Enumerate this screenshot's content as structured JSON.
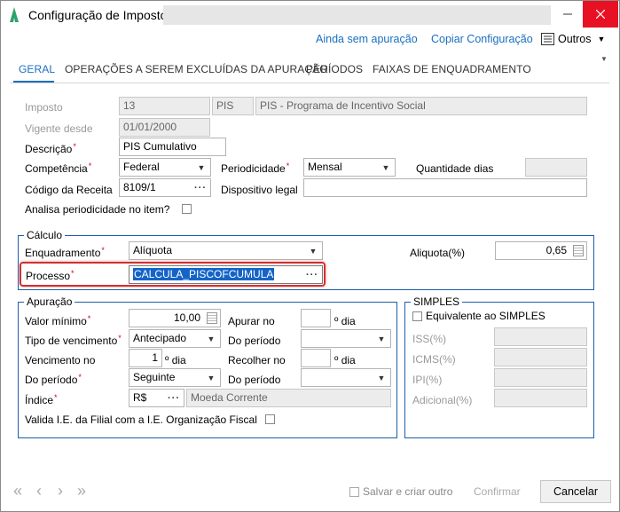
{
  "window": {
    "title": "Configuração de Impostos"
  },
  "toolbar": {
    "link_no_calc": "Ainda sem apuração",
    "link_copy": "Copiar Configuração",
    "others_label": "Outros"
  },
  "tabs": [
    {
      "label": "GERAL",
      "active": true
    },
    {
      "label": "OPERAÇÕES A SEREM EXCLUÍDAS DA APURAÇÃO",
      "active": false
    },
    {
      "label": "PERÍODOS",
      "active": false
    },
    {
      "label": "FAIXAS DE ENQUADRAMENTO",
      "active": false
    }
  ],
  "general": {
    "imposto_label": "Imposto",
    "imposto_code": "13",
    "imposto_sigla": "PIS",
    "imposto_nome": "PIS - Programa de Incentivo Social",
    "vigente_label": "Vigente desde",
    "vigente_value": "01/01/2000",
    "descricao_label": "Descrição",
    "descricao_value": "PIS Cumulativo",
    "competencia_label": "Competência",
    "competencia_value": "Federal",
    "periodicidade_label": "Periodicidade",
    "periodicidade_value": "Mensal",
    "qtd_dias_label": "Quantidade dias",
    "qtd_dias_value": "",
    "codigo_receita_label": "Código da Receita",
    "codigo_receita_value": "8109/1",
    "dispositivo_label": "Dispositivo legal",
    "dispositivo_value": "",
    "analisa_label": "Analisa periodicidade no item?"
  },
  "calculo": {
    "title": "Cálculo",
    "enquadramento_label": "Enquadramento",
    "enquadramento_value": "Alíquota",
    "aliquota_label": "Aliquota(%)",
    "aliquota_value": "0,65",
    "processo_label": "Processo",
    "processo_value": "CALCULA_PISCOFCUMULA"
  },
  "apuracao": {
    "title": "Apuração",
    "valor_minimo_label": "Valor mínimo",
    "valor_minimo_value": "10,00",
    "tipo_venc_label": "Tipo de vencimento",
    "tipo_venc_value": "Antecipado",
    "vencimento_no_label": "Vencimento no",
    "vencimento_no_value": "1",
    "dia_suffix": "º dia",
    "do_periodo_label": "Do período",
    "do_periodo_value": "Seguinte",
    "indice_label": "Índice",
    "indice_value": "R$",
    "indice_desc": "Moeda Corrente",
    "apurar_no_label": "Apurar no",
    "apurar_no_value": "",
    "do_periodo2_label": "Do período",
    "do_periodo2_value": "",
    "recolher_no_label": "Recolher no",
    "recolher_no_value": "",
    "do_periodo3_label": "Do período",
    "do_periodo3_value": "",
    "valida_label": "Valida I.E. da Filial com a I.E. Organização Fiscal"
  },
  "simples": {
    "title": "SIMPLES",
    "equivalente_label": "Equivalente ao SIMPLES",
    "iss_label": "ISS(%)",
    "icms_label": "ICMS(%)",
    "ipi_label": "IPI(%)",
    "adicional_label": "Adicional(%)"
  },
  "footer": {
    "salvar_criar_label": "Salvar e criar outro",
    "confirmar_label": "Confirmar",
    "cancelar_label": "Cancelar"
  },
  "colors": {
    "accent": "#1a6fc0",
    "group_border": "#1a5fa8",
    "highlight": "#d32f2f",
    "selection": "#1464c8",
    "close": "#e81123"
  }
}
